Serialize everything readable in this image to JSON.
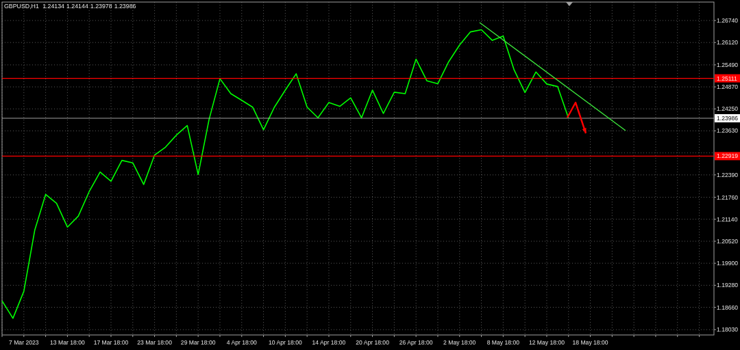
{
  "chart": {
    "header": {
      "symbol": "GBPUSD,H1",
      "quotes": [
        "1.24134",
        "1.24144",
        "1.23978",
        "1.23986"
      ]
    },
    "chart_data": {
      "type": "line",
      "grid": true,
      "categories": [
        null,
        null,
        "7 Mar 2023",
        null,
        null,
        null,
        "13 Mar 18:00",
        null,
        null,
        null,
        "17 Mar 18:00",
        null,
        null,
        null,
        "23 Mar 18:00",
        null,
        null,
        null,
        "29 Mar 18:00",
        null,
        null,
        null,
        "4 Apr 18:00",
        null,
        null,
        null,
        "10 Apr 18:00",
        null,
        null,
        null,
        "14 Apr 18:00",
        null,
        null,
        null,
        "20 Apr 18:00",
        null,
        null,
        null,
        "26 Apr 18:00",
        null,
        null,
        null,
        "2 May 18:00",
        null,
        null,
        null,
        "8 May 18:00",
        null,
        null,
        null,
        "12 May 18:00",
        null,
        null,
        null,
        "18 May 18:00",
        null,
        null,
        null,
        null,
        null,
        null,
        null
      ],
      "series": [
        {
          "color": "#00ff00",
          "values": [
            1.1884,
            1.1835,
            1.1911,
            1.2083,
            1.2184,
            1.2159,
            1.2092,
            1.2123,
            1.2192,
            1.2247,
            1.2221,
            1.228,
            1.2273,
            1.2212,
            1.2295,
            1.2317,
            1.2351,
            1.2378,
            1.224,
            1.2395,
            1.251,
            1.2468,
            1.2449,
            1.243,
            1.2366,
            1.243,
            1.2478,
            1.2524,
            1.243,
            1.24,
            1.2443,
            1.2432,
            1.2456,
            1.24,
            1.2478,
            1.2412,
            1.2472,
            1.2468,
            1.2565,
            1.2504,
            1.2496,
            1.2558,
            1.2605,
            1.2642,
            1.2648,
            1.2618,
            1.263,
            1.2535,
            1.2471,
            1.2529,
            1.2495,
            1.2488,
            1.2399,
            null,
            null,
            null,
            null,
            null,
            null,
            null,
            null,
            null
          ]
        }
      ],
      "ylim": [
        1.1788,
        1.2726
      ],
      "yticks": [
        {
          "value": 1.1803,
          "label": "1.18030"
        },
        {
          "value": 1.1866,
          "label": "1.18660"
        },
        {
          "value": 1.1928,
          "label": "1.19280"
        },
        {
          "value": 1.199,
          "label": "1.19900"
        },
        {
          "value": 1.2052,
          "label": "1.20520"
        },
        {
          "value": 1.2114,
          "label": "1.21140"
        },
        {
          "value": 1.2176,
          "label": "1.21760"
        },
        {
          "value": 1.2239,
          "label": "1.22390"
        },
        {
          "value": 1.2363,
          "label": "1.23630"
        },
        {
          "value": 1.2425,
          "label": "1.24250"
        },
        {
          "value": 1.2487,
          "label": "1.24870"
        },
        {
          "value": 1.2549,
          "label": "1.25490"
        },
        {
          "value": 1.2612,
          "label": "1.26120"
        },
        {
          "value": 1.2674,
          "label": "1.26740"
        }
      ],
      "ref_lines": [
        {
          "axis": "y",
          "value": 1.25111,
          "label": "1.25111",
          "color": "#ff0000"
        },
        {
          "axis": "y",
          "value": 1.22919,
          "label": "1.22919",
          "color": "#ff0000"
        },
        {
          "axis": "y",
          "value": 1.23986,
          "label": "1.23986",
          "color": "#c8c8c8"
        }
      ]
    }
  }
}
